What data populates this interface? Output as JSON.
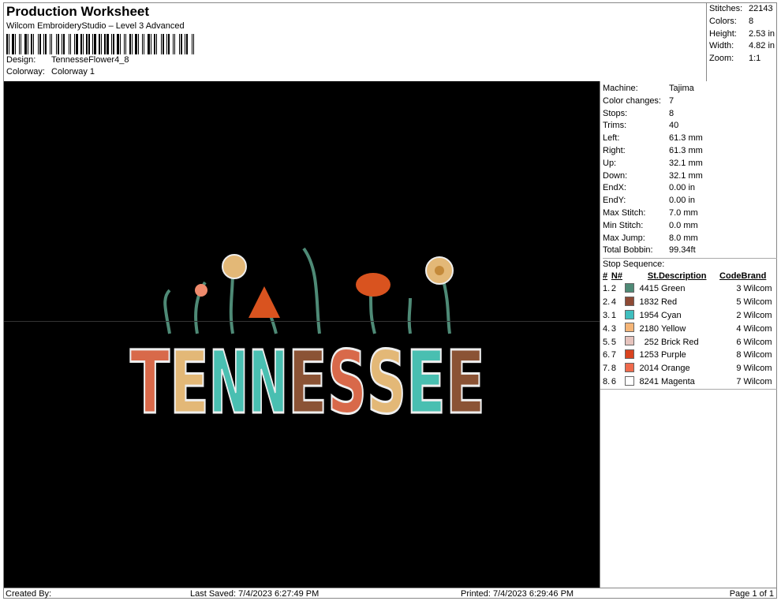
{
  "header": {
    "title": "Production Worksheet",
    "subtitle": "Wilcom EmbroideryStudio – Level 3 Advanced",
    "design_label": "Design:",
    "design": "TennesseFlower4_8",
    "colorway_label": "Colorway:",
    "colorway": "Colorway 1"
  },
  "summary": [
    {
      "k": "Stitches:",
      "v": "22143"
    },
    {
      "k": "Colors:",
      "v": "8"
    },
    {
      "k": "Height:",
      "v": "2.53 in"
    },
    {
      "k": "Width:",
      "v": "4.82 in"
    },
    {
      "k": "Zoom:",
      "v": "1:1"
    }
  ],
  "design_text": "TENNESSEE",
  "details": [
    {
      "k": "Machine:",
      "v": "Tajima"
    },
    {
      "k": "Color changes:",
      "v": "7"
    },
    {
      "k": "Stops:",
      "v": "8"
    },
    {
      "k": "Trims:",
      "v": "40"
    },
    {
      "k": "Left:",
      "v": "61.3 mm"
    },
    {
      "k": "Right:",
      "v": "61.3 mm"
    },
    {
      "k": "Up:",
      "v": "32.1 mm"
    },
    {
      "k": "Down:",
      "v": "32.1 mm"
    },
    {
      "k": "EndX:",
      "v": "0.00 in"
    },
    {
      "k": "EndY:",
      "v": "0.00 in"
    },
    {
      "k": "Max Stitch:",
      "v": "7.0 mm"
    },
    {
      "k": "Min Stitch:",
      "v": "0.0 mm"
    },
    {
      "k": "Max Jump:",
      "v": "8.0 mm"
    },
    {
      "k": "Total Bobbin:",
      "v": "99.34ft"
    }
  ],
  "stop_sequence": {
    "title": "Stop Sequence:",
    "headers": [
      "#",
      "N#",
      "St.",
      "Description",
      "Code",
      "Brand"
    ],
    "rows": [
      {
        "i": "1.",
        "n": "2",
        "color": "#4e8a76",
        "st": "4415",
        "desc": "Green",
        "code": "3",
        "brand": "Wilcom"
      },
      {
        "i": "2.",
        "n": "4",
        "color": "#8e4a35",
        "st": "1832",
        "desc": "Red",
        "code": "5",
        "brand": "Wilcom"
      },
      {
        "i": "3.",
        "n": "1",
        "color": "#3fbfbf",
        "st": "1954",
        "desc": "Cyan",
        "code": "2",
        "brand": "Wilcom"
      },
      {
        "i": "4.",
        "n": "3",
        "color": "#f5b577",
        "st": "2180",
        "desc": "Yellow",
        "code": "4",
        "brand": "Wilcom"
      },
      {
        "i": "5.",
        "n": "5",
        "color": "#e6c3bd",
        "st": "252",
        "desc": "Brick Red",
        "code": "6",
        "brand": "Wilcom"
      },
      {
        "i": "6.",
        "n": "7",
        "color": "#d9431f",
        "st": "1253",
        "desc": "Purple",
        "code": "8",
        "brand": "Wilcom"
      },
      {
        "i": "7.",
        "n": "8",
        "color": "#ef6a4c",
        "st": "2014",
        "desc": "Orange",
        "code": "9",
        "brand": "Wilcom"
      },
      {
        "i": "8.",
        "n": "6",
        "color": "#ffffff",
        "st": "8241",
        "desc": "Magenta",
        "code": "7",
        "brand": "Wilcom"
      }
    ]
  },
  "footer": {
    "created": "Created By:",
    "saved": "Last Saved: 7/4/2023 6:27:49 PM",
    "printed": "Printed: 7/4/2023 6:29:46 PM",
    "page": "Page 1 of 1"
  }
}
